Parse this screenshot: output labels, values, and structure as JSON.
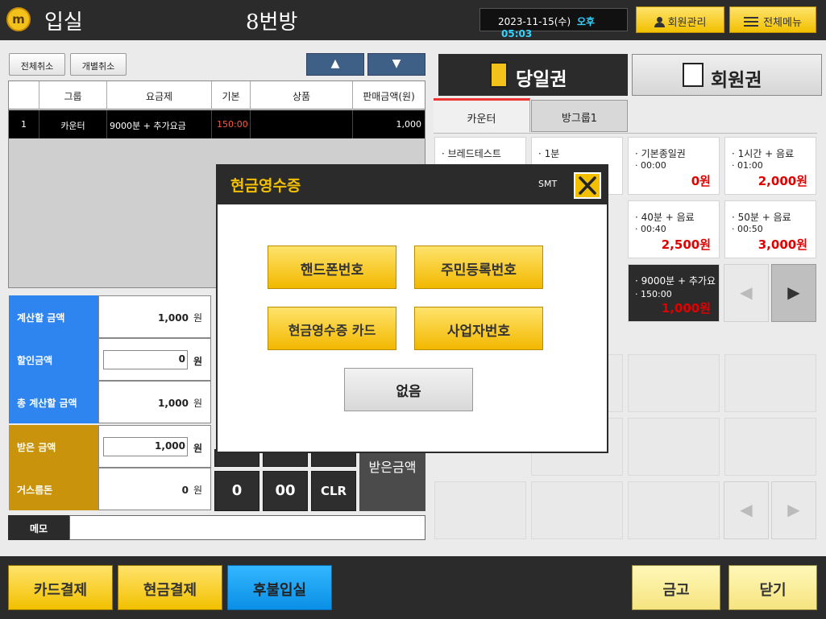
{
  "header": {
    "logo_glyph": "m",
    "title": "입실",
    "room": "8번방",
    "date": "2023-11-15(수)",
    "ampm": "오후",
    "time": "05:03",
    "member_mgmt": "회원관리",
    "all_menu": "전체메뉴"
  },
  "toolbar": {
    "cancel_all": "전체취소",
    "cancel_each": "개별취소",
    "up": "▲",
    "down": "▼"
  },
  "table": {
    "headers": [
      "",
      "그룹",
      "요금제",
      "기본",
      "상품",
      "판매금액(원)"
    ],
    "rows": [
      {
        "no": "1",
        "group": "카운터",
        "plan": "9000분 + 추가요금",
        "base": "150:00",
        "product": "",
        "amount": "1,000"
      }
    ]
  },
  "summary": {
    "calc_label": "계산할 금액",
    "calc_value": "1,000",
    "discount_label": "할인금액",
    "discount_value": "0",
    "total_label": "총 계산할 금액",
    "total_value": "1,000",
    "received_label": "받은 금액",
    "received_value": "1,000",
    "change_label": "거스름돈",
    "change_value": "0",
    "unit": "원"
  },
  "memo": {
    "label": "메모",
    "value": ""
  },
  "keypad": {
    "zero": "0",
    "double_zero": "00",
    "clear": "CLR",
    "received": "받은금액"
  },
  "right": {
    "tab_day": "당일권",
    "tab_member": "회원권",
    "subtab_counter": "카운터",
    "subtab_group1": "방그룹1",
    "tiles": [
      {
        "name": "· 브레드테스트",
        "time": "",
        "price": ""
      },
      {
        "name": "· 1분",
        "time": "",
        "price": ""
      },
      {
        "name": "· 기본종일권",
        "time": "· 00:00",
        "price": "0원"
      },
      {
        "name": "· 1시간 + 음료",
        "time": "· 01:00",
        "price": "2,000원"
      },
      {
        "name": "· 40분 + 음료",
        "time": "· 00:40",
        "price": "2,500원"
      },
      {
        "name": "· 50분 + 음료",
        "time": "· 00:50",
        "price": "3,000원"
      },
      {
        "name": "· 9000분 + 추가요",
        "time": "· 150:00",
        "price": "1,000원"
      }
    ],
    "arrow_left": "◀",
    "arrow_right": "▶"
  },
  "bottom": {
    "card_pay": "카드결제",
    "cash_pay": "현금결제",
    "postpaid": "후불입실",
    "safe": "금고",
    "close": "닫기"
  },
  "modal": {
    "title": "현금영수증",
    "smt": "SMT",
    "close_glyph": "✕",
    "phone": "핸드폰번호",
    "resident": "주민등록번호",
    "card": "현금영수증 카드",
    "business": "사업자번호",
    "none": "없음"
  },
  "colors": {
    "accent": "#f2c000",
    "dark": "#2b2b2b",
    "blue": "#2f85ef",
    "gold": "#c9940b",
    "price_red": "#e00000",
    "time_cyan": "#37d3ff"
  }
}
